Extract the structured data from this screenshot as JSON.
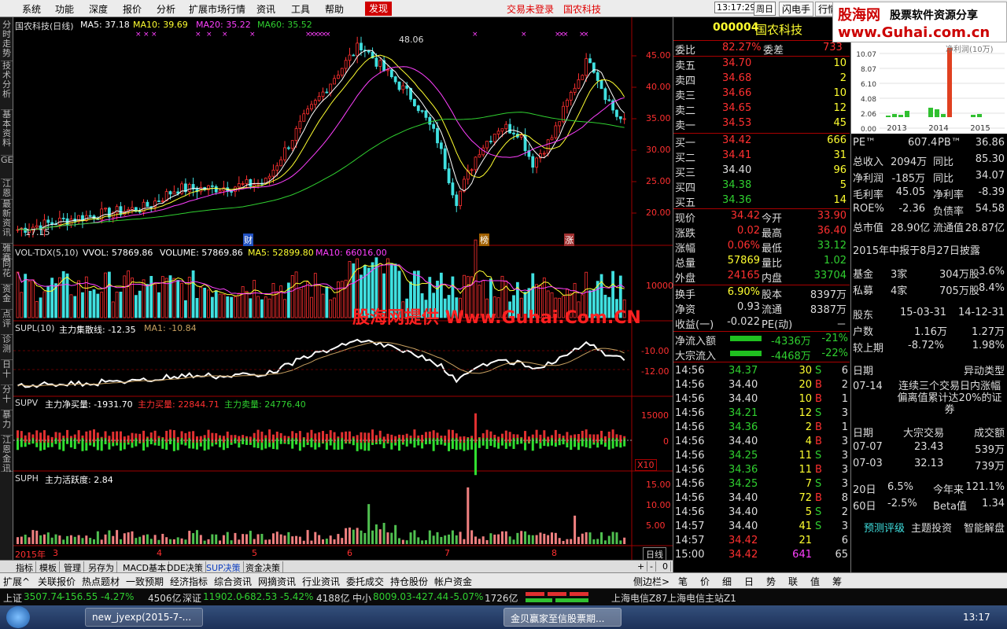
{
  "menu": {
    "items": [
      "系统",
      "功能",
      "深度",
      "报价",
      "分析",
      "扩展市场行情",
      "资讯",
      "工具",
      "帮助"
    ],
    "active": "发现",
    "trade_notice": "交易未登录",
    "stock_title": "国农科技",
    "time": "13:17:29",
    "weekday": "周日",
    "btn1": "闪电手",
    "btn2": "行情"
  },
  "watermark_logo": {
    "line1": "股海网",
    "line1b": "股票软件资源分享",
    "line2": "www.Guhai.com.cn"
  },
  "lefttabs": [
    "分时走势",
    "技术分析",
    "基本资料",
    "GET",
    "江恩",
    "最新资讯",
    "雅赛",
    "同花",
    "资金",
    "点评",
    "诊测",
    "日十",
    "分十",
    "暴力",
    "江恩金讯"
  ],
  "chart": {
    "header": {
      "name": "国农科技(日线)",
      "ma5": "MA5: 37.18",
      "ma10": "MA10: 39.69",
      "ma20": "MA20: 35.22",
      "ma60": "MA60: 35.52"
    },
    "price_ticks": [
      "45.00",
      "40.00",
      "35.00",
      "30.00",
      "25.00",
      "20.00"
    ],
    "high_label": "48.06",
    "low_label": "17.15",
    "markers": [
      "财",
      "榜",
      "涨"
    ],
    "vol_header": {
      "name": "VOL-TDX(5,10)",
      "vvol": "VVOL: 57869.86",
      "volume": "VOLUME: 57869.86",
      "ma5": "MA5: 52899.80",
      "ma10": "MA10: 66016.00"
    },
    "vol_tick": "10000",
    "supl_header": {
      "name": "SUPL(10)",
      "desc": "主力集散线: -12.35",
      "ma1": "MA1: -10.84"
    },
    "supl_ticks": [
      "-10.00",
      "-12.00"
    ],
    "supv_header": {
      "name": "SUPV",
      "net": "主力净买量: -1931.70",
      "buy": "主力买量: 22844.71",
      "sell": "主力卖量: 24776.40"
    },
    "supv_ticks": [
      "15000",
      "0"
    ],
    "supv_scale": "X10",
    "suph_header": {
      "name": "SUPH",
      "desc": "主力活跃度: 2.84"
    },
    "suph_ticks": [
      "15.00",
      "10.00",
      "5.00"
    ],
    "date_axis": [
      "2015年",
      "3",
      "4",
      "5",
      "6",
      "7",
      "8"
    ],
    "period": "日线"
  },
  "bottabs": [
    "指标",
    "模板",
    "管理",
    "另存为",
    "MACD基本",
    "DDE决策",
    "SUP决策",
    "资金决策"
  ],
  "bottabs_right": [
    "+",
    "-",
    "0"
  ],
  "bottabs2": [
    "扩展^",
    "关联报价",
    "热点题材",
    "一致预期",
    "经济指标",
    "综合资讯",
    "网摘资讯",
    "行业资讯",
    "委托成交",
    "持仓股份",
    "帐户资金"
  ],
  "bottabs2_right": [
    "侧边栏>",
    "笔",
    "价",
    "细",
    "日",
    "势",
    "联",
    "值",
    "筹"
  ],
  "quote": {
    "code": "000004",
    "name": "国农科技",
    "weibi_label": "委比",
    "weibi": "82.27%",
    "weicha_label": "委差",
    "weicha": "733",
    "sells": [
      {
        "l": "卖五",
        "p": "34.70",
        "v": "10"
      },
      {
        "l": "卖四",
        "p": "34.68",
        "v": "2"
      },
      {
        "l": "卖三",
        "p": "34.66",
        "v": "10"
      },
      {
        "l": "卖二",
        "p": "34.65",
        "v": "12"
      },
      {
        "l": "卖一",
        "p": "34.53",
        "v": "45"
      }
    ],
    "buys": [
      {
        "l": "买一",
        "p": "34.42",
        "v": "666"
      },
      {
        "l": "买二",
        "p": "34.41",
        "v": "31"
      },
      {
        "l": "买三",
        "p": "34.40",
        "v": "96"
      },
      {
        "l": "买四",
        "p": "34.38",
        "v": "5"
      },
      {
        "l": "买五",
        "p": "34.36",
        "v": "14"
      }
    ],
    "stats": [
      {
        "a": "现价",
        "av": "34.42",
        "b": "今开",
        "bv": "33.90"
      },
      {
        "a": "涨跌",
        "av": "0.02",
        "b": "最高",
        "bv": "36.40"
      },
      {
        "a": "涨幅",
        "av": "0.06%",
        "b": "最低",
        "bv": "33.12"
      },
      {
        "a": "总量",
        "av": "57869",
        "b": "量比",
        "bv": "1.02"
      },
      {
        "a": "外盘",
        "av": "24165",
        "b": "内盘",
        "bv": "33704"
      }
    ],
    "stats2": [
      {
        "a": "换手",
        "av": "6.90%",
        "b": "股本",
        "bv": "8397万"
      },
      {
        "a": "净资",
        "av": "0.93",
        "b": "流通",
        "bv": "8387万"
      },
      {
        "a": "收益(一)",
        "av": "-0.022",
        "b": "PE(动)",
        "bv": "－"
      }
    ],
    "flows": [
      {
        "l": "净流入额",
        "v": "-4336万",
        "p": "-21%"
      },
      {
        "l": "大宗流入",
        "v": "-4468万",
        "p": "-22%"
      }
    ],
    "ticks": [
      {
        "t": "14:56",
        "p": "34.37",
        "v": "30",
        "s": "S",
        "n": "6"
      },
      {
        "t": "14:56",
        "p": "34.40",
        "v": "20",
        "s": "B",
        "n": "2"
      },
      {
        "t": "14:56",
        "p": "34.40",
        "v": "10",
        "s": "B",
        "n": "1"
      },
      {
        "t": "14:56",
        "p": "34.21",
        "v": "12",
        "s": "S",
        "n": "3"
      },
      {
        "t": "14:56",
        "p": "34.36",
        "v": "2",
        "s": "B",
        "n": "1"
      },
      {
        "t": "14:56",
        "p": "34.40",
        "v": "4",
        "s": "B",
        "n": "3"
      },
      {
        "t": "14:56",
        "p": "34.25",
        "v": "11",
        "s": "S",
        "n": "3"
      },
      {
        "t": "14:56",
        "p": "34.36",
        "v": "11",
        "s": "B",
        "n": "3"
      },
      {
        "t": "14:56",
        "p": "34.25",
        "v": "7",
        "s": "S",
        "n": "3"
      },
      {
        "t": "14:56",
        "p": "34.40",
        "v": "72",
        "s": "B",
        "n": "8"
      },
      {
        "t": "14:56",
        "p": "34.40",
        "v": "5",
        "s": "S",
        "n": "2"
      },
      {
        "t": "14:57",
        "p": "34.40",
        "v": "41",
        "s": "S",
        "n": "3"
      },
      {
        "t": "14:57",
        "p": "34.42",
        "v": "21",
        "s": "",
        "n": "6"
      },
      {
        "t": "15:00",
        "p": "34.42",
        "v": "641",
        "s": "",
        "n": "65"
      }
    ]
  },
  "fund": {
    "chart_title": "净利润(10万)",
    "chart_ticks": [
      "10.07",
      "8.07",
      "6.10",
      "4.08",
      "2.06",
      "0.00"
    ],
    "chart_years": [
      "2013",
      "2014",
      "2015"
    ],
    "pe_label": "PE™",
    "pe": "607.4",
    "pb_label": "PB™",
    "pb": "36.86",
    "rows": [
      {
        "a": "总收入",
        "av": "2094万",
        "b": "同比",
        "bv": "85.30"
      },
      {
        "a": "净利润",
        "av": "-185万",
        "b": "同比",
        "bv": "34.07"
      },
      {
        "a": "毛利率",
        "av": "45.05",
        "b": "净利率",
        "bv": "-8.39"
      },
      {
        "a": "ROE%",
        "av": "-2.36",
        "b": "负债率",
        "bv": "54.58"
      },
      {
        "a": "总市值",
        "av": "28.90亿",
        "b": "流通值",
        "bv": "28.87亿"
      }
    ],
    "notice": "2015年中报于8月27日披露",
    "holders": [
      {
        "a": "基金",
        "b": "3家",
        "c": "304万股",
        "d": "3.6%"
      },
      {
        "a": "私募",
        "b": "4家",
        "c": "705万股",
        "d": "8.4%"
      }
    ],
    "sh": {
      "label": "股东",
      "d1": "15-03-31",
      "d2": "14-12-31",
      "r1": "户数",
      "v1": "1.16万",
      "v2": "1.27万",
      "r2": "较上期",
      "v3": "-8.72%",
      "v4": "1.98%"
    },
    "event": {
      "h1": "日期",
      "h2": "异动类型",
      "date": "07-14",
      "text": "连续三个交易日内涨幅偏离值累计达20%的证券"
    },
    "block": {
      "h1": "日期",
      "h2": "大宗交易",
      "h3": "成交额",
      "rows": [
        {
          "d": "07-07",
          "p": "23.43",
          "a": "539万"
        },
        {
          "d": "07-03",
          "p": "32.13",
          "a": "739万"
        }
      ]
    },
    "perf": [
      {
        "a": "20日",
        "b": "6.5%",
        "c": "今年来",
        "d": "121.1%"
      },
      {
        "a": "60日",
        "b": "-2.5%",
        "c": "Beta值",
        "d": "1.34"
      }
    ],
    "links": [
      "预测评级",
      "主题投资",
      "智能解盘"
    ]
  },
  "status": {
    "sh_label": "上证",
    "sh": "3507.74",
    "sh_ch": "-156.55",
    "sh_pct": "-4.27%",
    "sh_amt": "4506亿",
    "sz_label": "深证",
    "sz": "11902.0",
    "sz_ch": "-682.53",
    "sz_pct": "-5.42%",
    "sz_amt": "4188亿",
    "zx_label": "中小",
    "zx": "8009.03",
    "zx_ch": "-427.44",
    "zx_pct": "-5.07%",
    "zx_amt": "1726亿",
    "srv1": "上海电信Z87",
    "srv2": "上海电信主站Z1"
  },
  "taskbar": {
    "t1": "new_jyexp(2015-7-...",
    "t2": "金贝赢家至信股票期...",
    "clock": "13:17"
  },
  "overlay_wm": "股海网提供 Www.Guhai.Com.CN"
}
